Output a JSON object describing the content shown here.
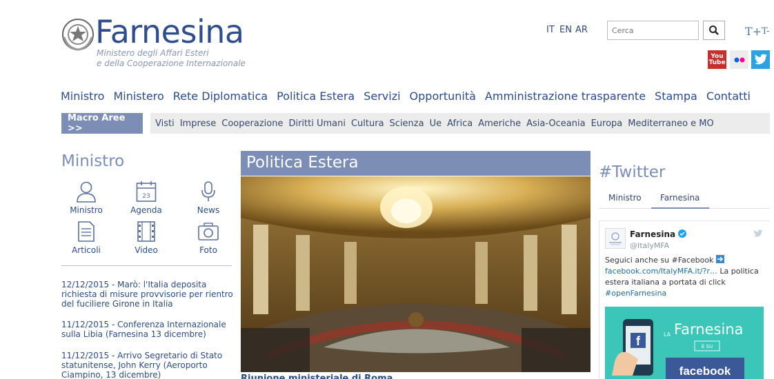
{
  "header": {
    "logo_title": "Farnesina",
    "logo_sub_1": "Ministero degli Affari Esteri",
    "logo_sub_2": "e della Cooperazione Internazionale",
    "languages": [
      "IT",
      "EN",
      "AR"
    ],
    "search_placeholder": "Cerca",
    "text_bigger": "T+",
    "text_smaller": "T-",
    "social": {
      "youtube_top": "You",
      "youtube_bottom": "Tube"
    }
  },
  "main_nav": [
    "Ministro",
    "Ministero",
    "Rete Diplomatica",
    "Politica Estera",
    "Servizi",
    "Opportunità",
    "Amministrazione trasparente",
    "Stampa",
    "Contatti"
  ],
  "sub_nav": {
    "macro_label": "Macro Aree >>",
    "items": [
      "Visti",
      "Imprese",
      "Cooperazione",
      "Diritti Umani",
      "Cultura",
      "Scienza",
      "Ue",
      "Africa",
      "Americhe",
      "Asia-Oceania",
      "Europa",
      "Mediterraneo e MO"
    ]
  },
  "ministro": {
    "title": "Ministro",
    "icons": [
      {
        "label": "Ministro",
        "icon": "person-icon"
      },
      {
        "label": "Agenda",
        "icon": "calendar-icon",
        "day": "23"
      },
      {
        "label": "News",
        "icon": "microphone-icon"
      },
      {
        "label": "Articoli",
        "icon": "document-icon"
      },
      {
        "label": "Video",
        "icon": "film-icon"
      },
      {
        "label": "Foto",
        "icon": "camera-icon"
      }
    ],
    "news": [
      "12/12/2015 - Marò: l'Italia deposita richiesta di misure provvisorie per rientro del fuciliere Girone in Italia",
      "11/12/2015 - Conferenza Internazionale sulla Libia (Farnesina 13 dicembre)",
      "11/12/2015 - Arrivo Segretario di Stato statunitense, John Kerry (Aeroporto Ciampino, 13 dicembre)"
    ]
  },
  "politica": {
    "title": "Politica Estera",
    "caption": "Riunione ministeriale di Roma"
  },
  "twitter": {
    "title": "#Twitter",
    "tabs": [
      "Ministro",
      "Farnesina"
    ],
    "active_tab": "Farnesina",
    "name": "Farnesina",
    "handle": "@ItalyMFA",
    "line1": "Seguici anche su #Facebook",
    "line2_link": "facebook.com/ItalyMFA.it/?r…",
    "line2_rest": " La politica estera italiana a portata di click",
    "line3": "#openFarnesina",
    "card_la": "LA",
    "card_title": "Farnesina",
    "card_esu": "È SU",
    "card_fb": "facebook"
  },
  "colors": {
    "brand": "#2f4d8c",
    "accent": "#7c8db6",
    "twitter": "#1da1f2",
    "facebook_card": "#3cc5b9"
  }
}
